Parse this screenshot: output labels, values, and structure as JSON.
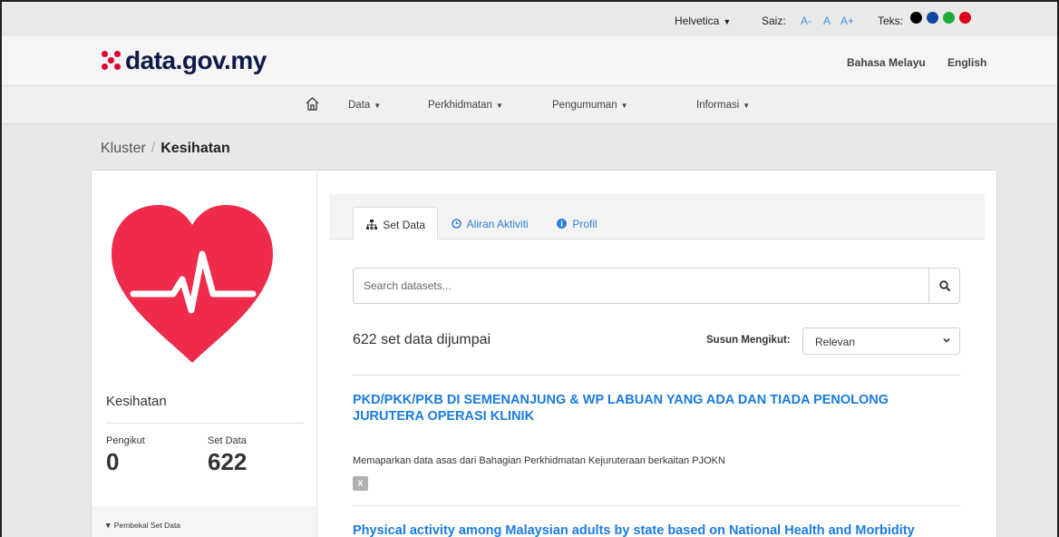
{
  "utility": {
    "font_value": "Helvetica",
    "size_label": "Saiz:",
    "size_options": [
      "A-",
      "A",
      "A+"
    ],
    "text_label": "Teks:",
    "text_colors": [
      "#000000",
      "#0d47a1",
      "#1faa38",
      "#e0001b"
    ]
  },
  "header": {
    "logo_text": "data.gov.my",
    "languages": [
      "Bahasa Melayu",
      "English"
    ]
  },
  "nav": {
    "items": [
      "Data",
      "Perkhidmatan",
      "Pengumuman",
      "Informasi"
    ]
  },
  "breadcrumb": {
    "parent": "Kluster",
    "separator": "/",
    "current": "Kesihatan"
  },
  "sidebar": {
    "org_name": "Kesihatan",
    "followers_label": "Pengikut",
    "followers_value": "0",
    "datasets_label": "Set Data",
    "datasets_value": "622",
    "filter_label": "Pembekal Set Data"
  },
  "tabs": [
    "Set Data",
    "Aliran Aktiviti",
    "Profil"
  ],
  "search": {
    "placeholder": "Search datasets..."
  },
  "results": {
    "count_text": "622 set data dijumpai",
    "sort_label": "Susun Mengikut:",
    "sort_value": "Relevan"
  },
  "datasets": [
    {
      "title": "PKD/PKK/PKB DI SEMENANJUNG & WP LABUAN YANG ADA DAN TIADA PENOLONG JURUTERA OPERASI KLINIK",
      "description": "Memaparkan data asas dari Bahagian Perkhidmatan Kejuruteraan berkaitan PJOKN",
      "format": "X"
    },
    {
      "title": "Physical activity among Malaysian adults by state based on National Health and Morbidity Survey"
    }
  ],
  "colors": {
    "link": "#1a7be0",
    "heart": "#ef2b4b",
    "logo_text": "#0e1a47"
  }
}
